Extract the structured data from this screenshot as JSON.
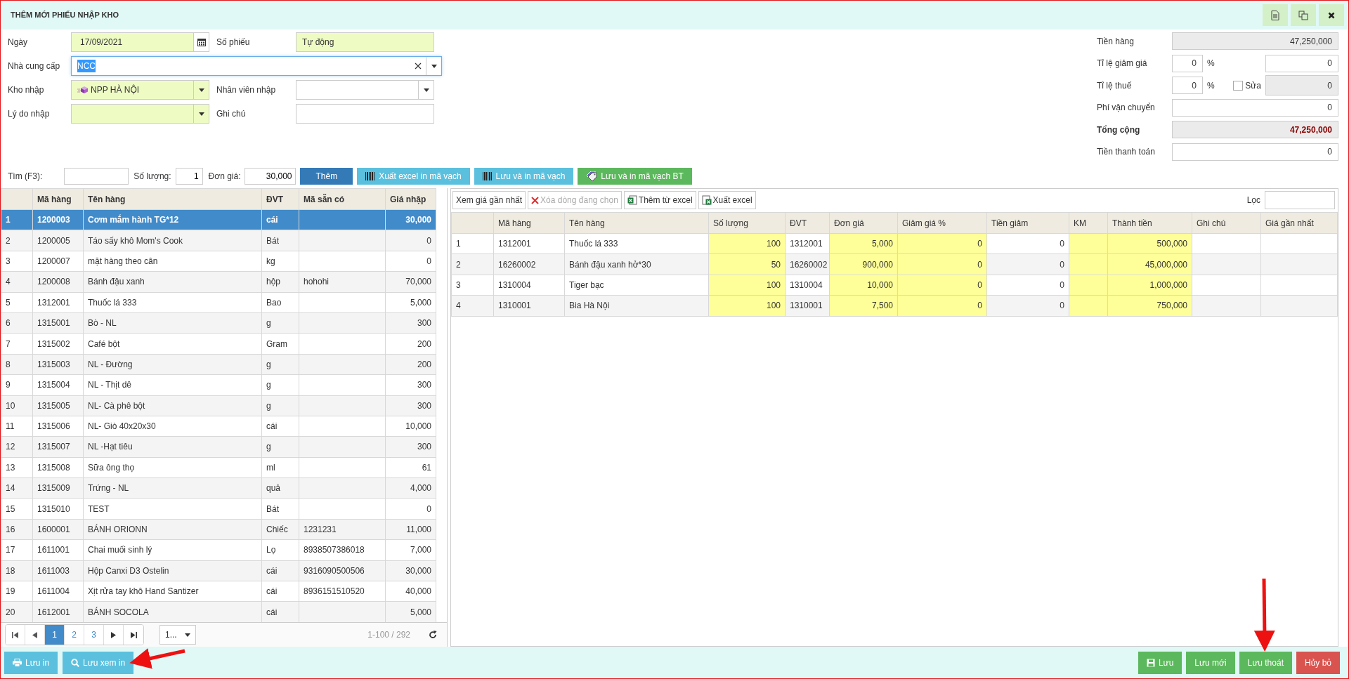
{
  "window": {
    "title": "THÊM MỚI PHIẾU NHẬP KHO"
  },
  "form": {
    "rows": [
      [
        {
          "label": "Ngày",
          "kind": "date",
          "value": "17/09/2021",
          "required": true
        },
        {
          "label": "Số phiếu",
          "kind": "text",
          "value": "Tự động",
          "required": true
        }
      ],
      [
        {
          "label": "Nhà cung cấp",
          "kind": "combo_clear",
          "value": "NCC",
          "required": false,
          "focused": true
        }
      ],
      [
        {
          "label": "Kho nhập",
          "kind": "combo",
          "value": "NPP HÀ NỘI",
          "required": true
        },
        {
          "label": "Nhân viên nhập",
          "kind": "combo",
          "required": false
        }
      ],
      [
        {
          "label": "Lý do nhập",
          "kind": "combo",
          "required": true
        },
        {
          "label": "Ghi chú",
          "kind": "text",
          "required": false
        }
      ]
    ]
  },
  "totals": [
    {
      "label": "Tiền hàng",
      "kind": "plain",
      "value": "47,250,000",
      "readonly": true,
      "emphasis": false
    },
    {
      "label": "Tỉ lệ giảm giá",
      "kind": "percent",
      "percent": "0",
      "unit": "%",
      "value": "0",
      "readonly": false
    },
    {
      "label": "Tỉ lệ thuế",
      "kind": "percent_check",
      "percent": "0",
      "unit": "%",
      "check_label": "Sửa",
      "checked": false,
      "value": "0",
      "readonly": true
    },
    {
      "label": "Phí vận chuyển",
      "kind": "plain",
      "value": "0",
      "readonly": false,
      "emphasis": false
    },
    {
      "label": "Tổng cộng",
      "kind": "plain",
      "value": "47,250,000",
      "readonly": true,
      "emphasis": true
    },
    {
      "label": "Tiền thanh toán",
      "kind": "plain",
      "value": "0",
      "readonly": false,
      "emphasis": false
    }
  ],
  "toolbar": {
    "search_label": "Tìm (F3):",
    "quantity_label": "Số lượng:",
    "quantity": "1",
    "price_label": "Đơn giá:",
    "price": "30,000",
    "buttons": [
      {
        "label": "Thêm",
        "kind": "primary"
      },
      {
        "label": "Xuất excel in mã vạch",
        "kind": "info"
      },
      {
        "label": "Lưu và in mã vạch",
        "kind": "info"
      },
      {
        "label": "Lưu và in mã vạch BT",
        "kind": "success"
      }
    ]
  },
  "product_table": {
    "columns": [
      "",
      "Mã hàng",
      "Tên hàng",
      "ĐVT",
      "Mã sẵn có",
      "Giá nhập"
    ],
    "rows": [
      {
        "cells": [
          "1",
          "1200003",
          "Cơm mắm hành TG*12",
          "cái",
          null,
          "30,000"
        ],
        "selected": true
      },
      {
        "cells": [
          "2",
          "1200005",
          "Táo sấy khô Mom's Cook",
          "Bát",
          null,
          "0"
        ],
        "selected": false
      },
      {
        "cells": [
          "3",
          "1200007",
          "mặt hàng theo cân",
          "kg",
          null,
          "0"
        ],
        "selected": false
      },
      {
        "cells": [
          "4",
          "1200008",
          "Bánh đậu xanh",
          "hộp",
          "hohohi",
          "70,000"
        ],
        "selected": false
      },
      {
        "cells": [
          "5",
          "1312001",
          "Thuốc lá 333",
          "Bao",
          null,
          "5,000"
        ],
        "selected": false
      },
      {
        "cells": [
          "6",
          "1315001",
          "Bò - NL",
          "g",
          null,
          "300"
        ],
        "selected": false
      },
      {
        "cells": [
          "7",
          "1315002",
          "Café bột",
          "Gram",
          null,
          "200"
        ],
        "selected": false
      },
      {
        "cells": [
          "8",
          "1315003",
          "NL - Đường",
          "g",
          null,
          "200"
        ],
        "selected": false
      },
      {
        "cells": [
          "9",
          "1315004",
          "NL - Thịt dê",
          "g",
          null,
          "300"
        ],
        "selected": false
      },
      {
        "cells": [
          "10",
          "1315005",
          "NL- Cà phê bột",
          "g",
          null,
          "300"
        ],
        "selected": false
      },
      {
        "cells": [
          "11",
          "1315006",
          "NL- Giò 40x20x30",
          "cái",
          null,
          "10,000"
        ],
        "selected": false
      },
      {
        "cells": [
          "12",
          "1315007",
          "NL -Hạt tiêu",
          "g",
          null,
          "300"
        ],
        "selected": false
      },
      {
        "cells": [
          "13",
          "1315008",
          "Sữa ông thọ",
          "ml",
          null,
          "61"
        ],
        "selected": false
      },
      {
        "cells": [
          "14",
          "1315009",
          "Trứng - NL",
          "quả",
          null,
          "4,000"
        ],
        "selected": false
      },
      {
        "cells": [
          "15",
          "1315010",
          "TEST",
          "Bát",
          null,
          "0"
        ],
        "selected": false
      },
      {
        "cells": [
          "16",
          "1600001",
          "BÁNH ORIONN",
          "Chiếc",
          "1231231",
          "11,000"
        ],
        "selected": false
      },
      {
        "cells": [
          "17",
          "1611001",
          "Chai muối sinh lý",
          "Lọ",
          "8938507386018",
          "7,000"
        ],
        "selected": false
      },
      {
        "cells": [
          "18",
          "1611003",
          "Hộp Canxi D3 Ostelin",
          "cái",
          "9316090500506",
          "30,000"
        ],
        "selected": false
      },
      {
        "cells": [
          "19",
          "1611004",
          "Xịt rửa tay khô Hand Santizer",
          "cái",
          "8936151510520",
          "40,000"
        ],
        "selected": false
      },
      {
        "cells": [
          "20",
          "1612001",
          "BÁNH SOCOLA",
          "cái",
          null,
          "5,000"
        ],
        "selected": false
      }
    ],
    "pager": {
      "pages": [
        {
          "label": "1",
          "selected": true
        },
        {
          "label": "2",
          "selected": false
        },
        {
          "label": "3",
          "selected": false
        }
      ],
      "page_size": "1...",
      "summary": "1-100 / 292"
    }
  },
  "detail_panel": {
    "buttons": [
      {
        "label": "Xem giá gần nhất",
        "disabled": false
      },
      {
        "label": "Xóa dòng đang chọn",
        "disabled": true
      },
      {
        "label": "Thêm từ excel",
        "disabled": false
      },
      {
        "label": "Xuất excel",
        "disabled": false
      }
    ],
    "filter_label": "Lọc",
    "columns": [
      {
        "editable": false
      },
      {
        "label": "Mã hàng",
        "editable": false
      },
      {
        "label": "Tên hàng",
        "editable": false
      },
      {
        "label": "Số lượng",
        "editable": true
      },
      {
        "label": "ĐVT",
        "editable": false
      },
      {
        "label": "Đơn giá",
        "editable": true
      },
      {
        "label": "Giảm giá %",
        "editable": true
      },
      {
        "label": "Tiền giảm",
        "editable": false
      },
      {
        "label": "KM",
        "editable": true
      },
      {
        "label": "Thành tiền",
        "editable": true
      },
      {
        "label": "Ghi chú",
        "editable": false
      },
      {
        "label": "Giá gần nhất",
        "editable": false
      }
    ],
    "rows": [
      [
        "1",
        "1312001",
        "Thuốc lá 333",
        "100",
        "1312001",
        "5,000",
        "0",
        "0",
        null,
        "500,000",
        null,
        null
      ],
      [
        "2",
        "16260002",
        "Bánh đậu xanh hở*30",
        "50",
        "16260002",
        "900,000",
        "0",
        "0",
        null,
        "45,000,000",
        null,
        null
      ],
      [
        "3",
        "1310004",
        "Tiger bạc",
        "100",
        "1310004",
        "10,000",
        "0",
        "0",
        null,
        "1,000,000",
        null,
        null
      ],
      [
        "4",
        "1310001",
        "Bia Hà Nội",
        "100",
        "1310001",
        "7,500",
        "0",
        "0",
        null,
        "750,000",
        null,
        null
      ]
    ]
  },
  "footer": {
    "left_buttons": [
      {
        "label": "Lưu in",
        "kind": "info"
      },
      {
        "label": "Lưu xem in",
        "kind": "info"
      }
    ],
    "right_buttons": [
      {
        "label": "Lưu",
        "kind": "success"
      },
      {
        "label": "Lưu mới",
        "kind": "success"
      },
      {
        "label": "Lưu thoát",
        "kind": "success"
      },
      {
        "label": "Hủy bỏ",
        "kind": "danger"
      }
    ]
  }
}
